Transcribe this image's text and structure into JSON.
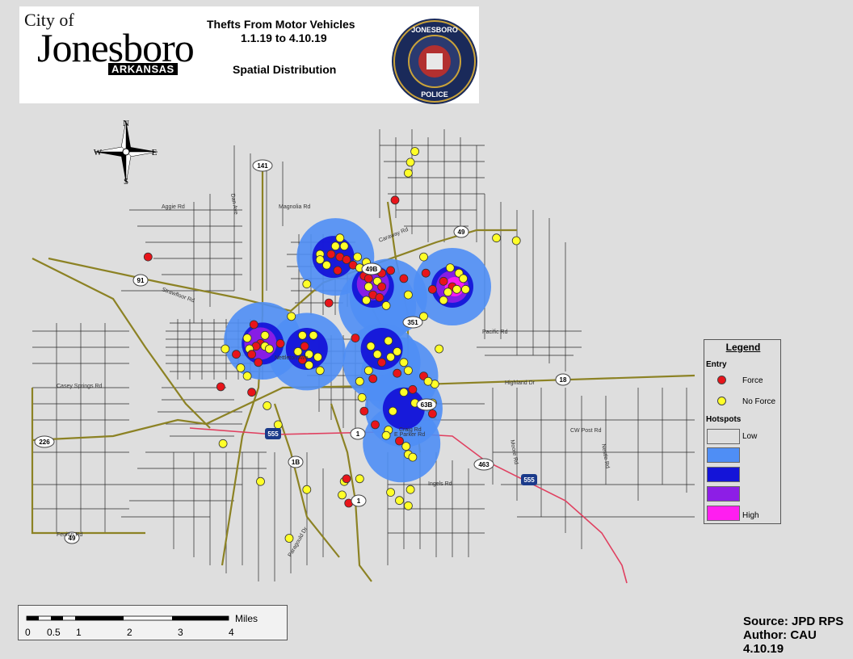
{
  "header": {
    "logo": {
      "city_prefix": "City of",
      "city_name": "Jonesboro",
      "state": "ARKANSAS"
    },
    "title_line1": "Thefts From Motor Vehicles",
    "title_line2": "1.1.19 to 4.10.19",
    "subtitle": "Spatial Distribution",
    "badge_text_top": "JONESBORO",
    "badge_text_bottom": "POLICE"
  },
  "compass": {
    "north": "N",
    "south": "S",
    "east": "E",
    "west": "W"
  },
  "roads": {
    "labels": [
      {
        "text": "141",
        "type": "shield"
      },
      {
        "text": "49",
        "type": "shield"
      },
      {
        "text": "49B",
        "type": "shield"
      },
      {
        "text": "91",
        "type": "shield"
      },
      {
        "text": "351",
        "type": "shield"
      },
      {
        "text": "18",
        "type": "shield"
      },
      {
        "text": "63B",
        "type": "shield"
      },
      {
        "text": "1",
        "type": "shield"
      },
      {
        "text": "555",
        "type": "interstate"
      },
      {
        "text": "1B",
        "type": "shield"
      },
      {
        "text": "463",
        "type": "shield"
      },
      {
        "text": "555",
        "type": "interstate"
      },
      {
        "text": "1",
        "type": "shield"
      },
      {
        "text": "226",
        "type": "shield"
      },
      {
        "text": "49",
        "type": "shield"
      },
      {
        "text": "Aggie Rd",
        "type": "street"
      },
      {
        "text": "Magnolia Rd",
        "type": "street"
      },
      {
        "text": "Caraway Rd",
        "type": "street"
      },
      {
        "text": "Pacific Rd",
        "type": "street"
      },
      {
        "text": "Highland Dr",
        "type": "street"
      },
      {
        "text": "Craig Rd",
        "type": "street"
      },
      {
        "text": "Moore Rd",
        "type": "street"
      },
      {
        "text": "Nestle Rd",
        "type": "street"
      },
      {
        "text": "CW Post Rd",
        "type": "street"
      },
      {
        "text": "Ingels Rd",
        "type": "street"
      },
      {
        "text": "Casey Springs Rd",
        "type": "street"
      },
      {
        "text": "Fenion Rd",
        "type": "street"
      },
      {
        "text": "Nettleton Ave",
        "type": "street"
      },
      {
        "text": "E Parker Rd",
        "type": "street"
      },
      {
        "text": "Dan Ave",
        "type": "street"
      },
      {
        "text": "Paragould Dr",
        "type": "street"
      },
      {
        "text": "Strawfloor Rd",
        "type": "street"
      }
    ]
  },
  "hotspots": [
    {
      "level": 2,
      "x": -90.705,
      "y": 35.862
    },
    {
      "level": 2,
      "x": -90.686,
      "y": 35.844
    },
    {
      "level": 2,
      "x": -90.681,
      "y": 35.847
    },
    {
      "level": 2,
      "x": -90.738,
      "y": 35.831
    },
    {
      "level": 2,
      "x": -90.718,
      "y": 35.827
    },
    {
      "level": 2,
      "x": -90.684,
      "y": 35.823
    },
    {
      "level": 2,
      "x": -90.676,
      "y": 35.818
    },
    {
      "level": 2,
      "x": -90.674,
      "y": 35.806
    },
    {
      "level": 2,
      "x": -90.675,
      "y": 35.793
    },
    {
      "level": 2,
      "x": -90.652,
      "y": 35.851
    },
    {
      "level": 3,
      "x": -90.706,
      "y": 35.862
    },
    {
      "level": 3,
      "x": -90.688,
      "y": 35.851
    },
    {
      "level": 3,
      "x": -90.738,
      "y": 35.83
    },
    {
      "level": 3,
      "x": -90.718,
      "y": 35.828
    },
    {
      "level": 3,
      "x": -90.684,
      "y": 35.828
    },
    {
      "level": 3,
      "x": -90.674,
      "y": 35.806
    },
    {
      "level": 3,
      "x": -90.652,
      "y": 35.851
    },
    {
      "level": 4,
      "x": -90.688,
      "y": 35.852
    },
    {
      "level": 4,
      "x": -90.739,
      "y": 35.83
    },
    {
      "level": 4,
      "x": -90.652,
      "y": 35.851
    },
    {
      "level": 5,
      "x": -90.651,
      "y": 35.851
    }
  ],
  "points": [
    {
      "f": 0,
      "x": -90.669,
      "y": 35.901
    },
    {
      "f": 0,
      "x": -90.671,
      "y": 35.897
    },
    {
      "f": 0,
      "x": -90.672,
      "y": 35.893
    },
    {
      "f": 1,
      "x": -90.678,
      "y": 35.883
    },
    {
      "f": 0,
      "x": -90.632,
      "y": 35.869
    },
    {
      "f": 1,
      "x": -90.79,
      "y": 35.862
    },
    {
      "f": 0,
      "x": -90.703,
      "y": 35.869
    },
    {
      "f": 0,
      "x": -90.705,
      "y": 35.866
    },
    {
      "f": 0,
      "x": -90.701,
      "y": 35.866
    },
    {
      "f": 0,
      "x": -90.712,
      "y": 35.863
    },
    {
      "f": 1,
      "x": -90.707,
      "y": 35.863
    },
    {
      "f": 1,
      "x": -90.703,
      "y": 35.862
    },
    {
      "f": 0,
      "x": -90.712,
      "y": 35.861
    },
    {
      "f": 0,
      "x": -90.709,
      "y": 35.859
    },
    {
      "f": 1,
      "x": -90.7,
      "y": 35.861
    },
    {
      "f": 0,
      "x": -90.695,
      "y": 35.862
    },
    {
      "f": 1,
      "x": -90.697,
      "y": 35.859
    },
    {
      "f": 0,
      "x": -90.694,
      "y": 35.858
    },
    {
      "f": 0,
      "x": -90.691,
      "y": 35.86
    },
    {
      "f": 1,
      "x": -90.692,
      "y": 35.855
    },
    {
      "f": 1,
      "x": -90.704,
      "y": 35.857
    },
    {
      "f": 0,
      "x": -90.686,
      "y": 35.857
    },
    {
      "f": 1,
      "x": -90.684,
      "y": 35.856
    },
    {
      "f": 1,
      "x": -90.68,
      "y": 35.857
    },
    {
      "f": 1,
      "x": -90.69,
      "y": 35.854
    },
    {
      "f": 0,
      "x": -90.686,
      "y": 35.853
    },
    {
      "f": 1,
      "x": -90.684,
      "y": 35.851
    },
    {
      "f": 0,
      "x": -90.69,
      "y": 35.851
    },
    {
      "f": 1,
      "x": -90.688,
      "y": 35.848
    },
    {
      "f": 0,
      "x": -90.691,
      "y": 35.846
    },
    {
      "f": 1,
      "x": -90.685,
      "y": 35.847
    },
    {
      "f": 0,
      "x": -90.682,
      "y": 35.844
    },
    {
      "f": 1,
      "x": -90.674,
      "y": 35.854
    },
    {
      "f": 0,
      "x": -90.665,
      "y": 35.862
    },
    {
      "f": 1,
      "x": -90.664,
      "y": 35.856
    },
    {
      "f": 0,
      "x": -90.672,
      "y": 35.848
    },
    {
      "f": 0,
      "x": -90.665,
      "y": 35.84
    },
    {
      "f": 1,
      "x": -90.661,
      "y": 35.85
    },
    {
      "f": 1,
      "x": -90.656,
      "y": 35.853
    },
    {
      "f": 0,
      "x": -90.653,
      "y": 35.858
    },
    {
      "f": 0,
      "x": -90.649,
      "y": 35.856
    },
    {
      "f": 0,
      "x": -90.647,
      "y": 35.854
    },
    {
      "f": 1,
      "x": -90.652,
      "y": 35.851
    },
    {
      "f": 0,
      "x": -90.65,
      "y": 35.85
    },
    {
      "f": 0,
      "x": -90.654,
      "y": 35.849
    },
    {
      "f": 0,
      "x": -90.646,
      "y": 35.85
    },
    {
      "f": 0,
      "x": -90.656,
      "y": 35.846
    },
    {
      "f": 0,
      "x": -90.623,
      "y": 35.868
    },
    {
      "f": 1,
      "x": -90.742,
      "y": 35.837
    },
    {
      "f": 0,
      "x": -90.737,
      "y": 35.833
    },
    {
      "f": 1,
      "x": -90.739,
      "y": 35.83
    },
    {
      "f": 1,
      "x": -90.741,
      "y": 35.829
    },
    {
      "f": 0,
      "x": -90.745,
      "y": 35.832
    },
    {
      "f": 0,
      "x": -90.744,
      "y": 35.828
    },
    {
      "f": 0,
      "x": -90.737,
      "y": 35.829
    },
    {
      "f": 1,
      "x": -90.743,
      "y": 35.826
    },
    {
      "f": 1,
      "x": -90.74,
      "y": 35.823
    },
    {
      "f": 0,
      "x": -90.735,
      "y": 35.828
    },
    {
      "f": 1,
      "x": -90.73,
      "y": 35.83
    },
    {
      "f": 1,
      "x": -90.75,
      "y": 35.826
    },
    {
      "f": 0,
      "x": -90.748,
      "y": 35.821
    },
    {
      "f": 0,
      "x": -90.745,
      "y": 35.818
    },
    {
      "f": 0,
      "x": -90.755,
      "y": 35.828
    },
    {
      "f": 0,
      "x": -90.725,
      "y": 35.84
    },
    {
      "f": 0,
      "x": -90.72,
      "y": 35.833
    },
    {
      "f": 0,
      "x": -90.715,
      "y": 35.833
    },
    {
      "f": 1,
      "x": -90.719,
      "y": 35.829
    },
    {
      "f": 0,
      "x": -90.722,
      "y": 35.827
    },
    {
      "f": 0,
      "x": -90.717,
      "y": 35.826
    },
    {
      "f": 0,
      "x": -90.713,
      "y": 35.825
    },
    {
      "f": 1,
      "x": -90.72,
      "y": 35.824
    },
    {
      "f": 0,
      "x": -90.717,
      "y": 35.822
    },
    {
      "f": 0,
      "x": -90.712,
      "y": 35.82
    },
    {
      "f": 1,
      "x": -90.743,
      "y": 35.812
    },
    {
      "f": 1,
      "x": -90.696,
      "y": 35.832
    },
    {
      "f": 0,
      "x": -90.689,
      "y": 35.829
    },
    {
      "f": 0,
      "x": -90.681,
      "y": 35.831
    },
    {
      "f": 0,
      "x": -90.686,
      "y": 35.826
    },
    {
      "f": 0,
      "x": -90.68,
      "y": 35.825
    },
    {
      "f": 1,
      "x": -90.684,
      "y": 35.823
    },
    {
      "f": 0,
      "x": -90.677,
      "y": 35.827
    },
    {
      "f": 0,
      "x": -90.674,
      "y": 35.823
    },
    {
      "f": 1,
      "x": -90.677,
      "y": 35.819
    },
    {
      "f": 0,
      "x": -90.672,
      "y": 35.82
    },
    {
      "f": 0,
      "x": -90.69,
      "y": 35.82
    },
    {
      "f": 0,
      "x": -90.694,
      "y": 35.816
    },
    {
      "f": 1,
      "x": -90.688,
      "y": 35.817
    },
    {
      "f": 0,
      "x": -90.693,
      "y": 35.81
    },
    {
      "f": 1,
      "x": -90.692,
      "y": 35.805
    },
    {
      "f": 1,
      "x": -90.665,
      "y": 35.818
    },
    {
      "f": 0,
      "x": -90.66,
      "y": 35.815
    },
    {
      "f": 0,
      "x": -90.674,
      "y": 35.812
    },
    {
      "f": 1,
      "x": -90.67,
      "y": 35.813
    },
    {
      "f": 0,
      "x": -90.661,
      "y": 35.808
    },
    {
      "f": 1,
      "x": -90.661,
      "y": 35.804
    },
    {
      "f": 0,
      "x": -90.663,
      "y": 35.816
    },
    {
      "f": 0,
      "x": -90.669,
      "y": 35.808
    },
    {
      "f": 0,
      "x": -90.736,
      "y": 35.807
    },
    {
      "f": 0,
      "x": -90.731,
      "y": 35.8
    },
    {
      "f": 0,
      "x": -90.681,
      "y": 35.798
    },
    {
      "f": 1,
      "x": -90.687,
      "y": 35.8
    },
    {
      "f": 0,
      "x": -90.682,
      "y": 35.796
    },
    {
      "f": 1,
      "x": -90.676,
      "y": 35.794
    },
    {
      "f": 0,
      "x": -90.673,
      "y": 35.792
    },
    {
      "f": 0,
      "x": -90.672,
      "y": 35.789
    },
    {
      "f": 0,
      "x": -90.67,
      "y": 35.788
    },
    {
      "f": 0,
      "x": -90.739,
      "y": 35.779
    },
    {
      "f": 0,
      "x": -90.718,
      "y": 35.776
    },
    {
      "f": 0,
      "x": -90.701,
      "y": 35.779
    },
    {
      "f": 1,
      "x": -90.7,
      "y": 35.78
    },
    {
      "f": 0,
      "x": -90.702,
      "y": 35.774
    },
    {
      "f": 1,
      "x": -90.699,
      "y": 35.771
    },
    {
      "f": 0,
      "x": -90.694,
      "y": 35.78
    },
    {
      "f": 0,
      "x": -90.695,
      "y": 35.772
    },
    {
      "f": 0,
      "x": -90.68,
      "y": 35.775
    },
    {
      "f": 0,
      "x": -90.676,
      "y": 35.772
    },
    {
      "f": 0,
      "x": -90.672,
      "y": 35.77
    },
    {
      "f": 0,
      "x": -90.671,
      "y": 35.776
    },
    {
      "f": 0,
      "x": -90.726,
      "y": 35.758
    },
    {
      "f": 1,
      "x": -90.757,
      "y": 35.814
    },
    {
      "f": 0,
      "x": -90.756,
      "y": 35.793
    },
    {
      "f": 0,
      "x": -90.679,
      "y": 35.805
    },
    {
      "f": 0,
      "x": -90.658,
      "y": 35.828
    },
    {
      "f": 1,
      "x": -90.708,
      "y": 35.845
    },
    {
      "f": 0,
      "x": -90.718,
      "y": 35.852
    }
  ],
  "legend": {
    "title": "Legend",
    "entry_header": "Entry",
    "force_label": "Force",
    "no_force_label": "No Force",
    "hotspots_header": "Hotspots",
    "low_label": "Low",
    "high_label": "High",
    "colors": {
      "force": "#e8141a",
      "no_force": "#ffff28",
      "hot1": "#dedede",
      "hot2": "#4f8ef5",
      "hot3": "#1414d8",
      "hot4": "#8d1ee6",
      "hot5": "#ff1ef0"
    }
  },
  "scalebar": {
    "unit": "Miles",
    "ticks": [
      "0",
      "0.5",
      "1",
      "2",
      "3",
      "4"
    ]
  },
  "source": {
    "line1": "Source: JPD RPS",
    "line2": "Author: CAU",
    "line3": "4.10.19"
  }
}
